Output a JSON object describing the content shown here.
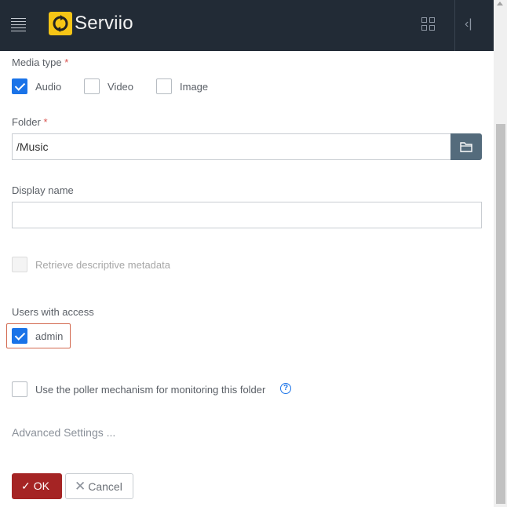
{
  "header": {
    "brand": "Serviio"
  },
  "form": {
    "media_type": {
      "label": "Media type",
      "required_mark": "*",
      "options": [
        {
          "label": "Audio",
          "checked": true
        },
        {
          "label": "Video",
          "checked": false
        },
        {
          "label": "Image",
          "checked": false
        }
      ]
    },
    "folder": {
      "label": "Folder",
      "required_mark": "*",
      "value": "/Music"
    },
    "display_name": {
      "label": "Display name",
      "value": ""
    },
    "retrieve_metadata": {
      "label": "Retrieve descriptive metadata",
      "checked": false,
      "disabled": true
    },
    "users": {
      "label": "Users with access",
      "items": [
        {
          "label": "admin",
          "checked": true
        }
      ]
    },
    "poller": {
      "label": "Use the poller mechanism for monitoring this folder",
      "checked": false,
      "help": "?"
    },
    "advanced_link": "Advanced Settings ...",
    "ok_label": "OK",
    "ok_icon": "✓",
    "cancel_label": "Cancel",
    "cancel_icon": "✕"
  },
  "colors": {
    "topbar": "#222b36",
    "accent": "#1a73e8",
    "ok": "#a52424",
    "logo": "#f6c516"
  }
}
